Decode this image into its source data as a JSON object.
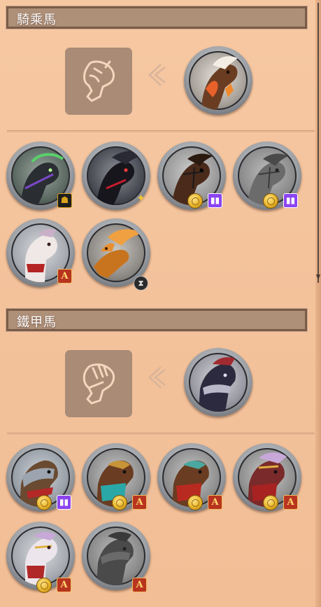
{
  "sections": [
    {
      "title": "騎乘馬"
    },
    {
      "title": "鐵甲馬"
    }
  ],
  "colors": {
    "background": "#f3c29b",
    "header_fill": "#ae8f78",
    "header_border": "#7a5b48",
    "tile_fill": "#a98b76",
    "twitch": "#8b44f0",
    "a_badge": "#b8341f",
    "gold_coin": "#e8b52a"
  },
  "riding": {
    "selected_icon": "horse-head-placeholder-icon",
    "horses": [
      {
        "id": "horse-green-spectral",
        "badges": [
          "mask-badge"
        ]
      },
      {
        "id": "horse-black-red",
        "badges": [
          "gold-sigil-badge"
        ]
      },
      {
        "id": "horse-brown-bridle",
        "badges": [
          "gold-coin",
          "twitch-badge"
        ]
      },
      {
        "id": "horse-grey-bridle",
        "badges": [
          "gold-coin",
          "twitch-badge"
        ]
      },
      {
        "id": "horse-white-red-harness",
        "badges": [
          "a-badge"
        ]
      },
      {
        "id": "horse-golden-pegasus",
        "badges": [
          "hourglass-badge"
        ]
      }
    ]
  },
  "armored": {
    "selected_icon": "armored-horse-placeholder-icon",
    "horses": [
      {
        "id": "horse-steel-plated",
        "badges": [
          "gold-coin",
          "twitch-badge"
        ]
      },
      {
        "id": "horse-teal-barding",
        "badges": [
          "gold-coin",
          "a-badge"
        ]
      },
      {
        "id": "horse-red-barding",
        "badges": [
          "gold-coin",
          "a-badge"
        ]
      },
      {
        "id": "horse-crimson-crest",
        "badges": [
          "gold-coin",
          "a-badge"
        ]
      },
      {
        "id": "horse-white-gold-barding",
        "badges": [
          "gold-coin",
          "a-badge"
        ]
      },
      {
        "id": "horse-locked-grey",
        "badges": [
          "a-badge"
        ]
      }
    ]
  },
  "badge_glyphs": {
    "twitch": "▮▮",
    "a": "A",
    "hourglass": "⧗",
    "mask": "☗",
    "sigil": "✦"
  }
}
